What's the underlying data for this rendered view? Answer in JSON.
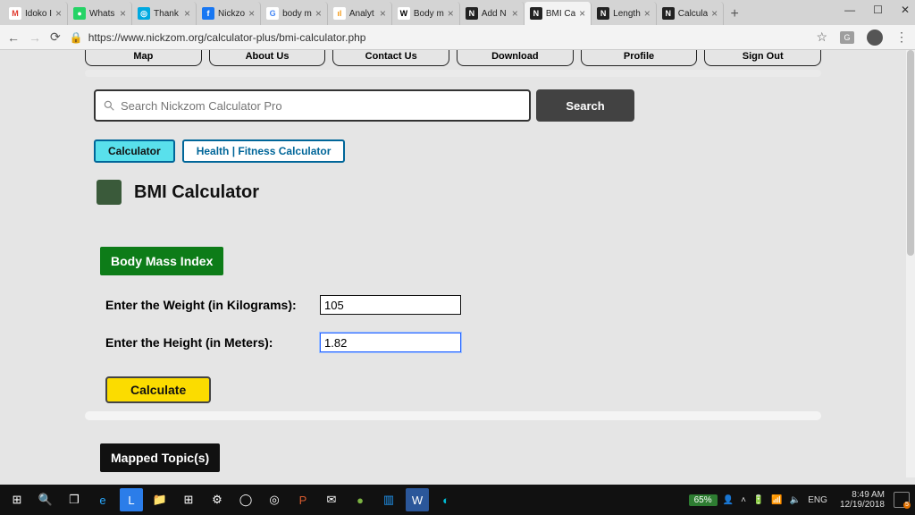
{
  "window_controls": {
    "min": "—",
    "max": "☐",
    "close": "✕"
  },
  "tabs": [
    {
      "title": "Idoko I",
      "color": "#e03a2e",
      "glyph": "M"
    },
    {
      "title": "Whats",
      "color": "#25d366",
      "glyph": "●"
    },
    {
      "title": "Thank",
      "color": "#00a9e0",
      "glyph": "◎"
    },
    {
      "title": "Nickzo",
      "color": "#1877f2",
      "glyph": "f"
    },
    {
      "title": "body m",
      "color": "#ffffff",
      "glyph": "G"
    },
    {
      "title": "Analyt",
      "color": "#f59c1a",
      "glyph": "ıl"
    },
    {
      "title": "Body m",
      "color": "#ffffff",
      "glyph": "W"
    },
    {
      "title": "Add N",
      "color": "#222222",
      "glyph": "N"
    },
    {
      "title": "BMI Ca",
      "color": "#222222",
      "glyph": "N",
      "active": true
    },
    {
      "title": "Length",
      "color": "#222222",
      "glyph": "N"
    },
    {
      "title": "Calcula",
      "color": "#222222",
      "glyph": "N"
    }
  ],
  "newtab": "+",
  "address": {
    "lock": "🔒",
    "url": "https://www.nickzom.org/calculator-plus/bmi-calculator.php",
    "star": "☆",
    "ext": "⋯",
    "menu": "⋮"
  },
  "topnav": [
    "Map",
    "About Us",
    "Contact Us",
    "Download",
    "Profile",
    "Sign Out"
  ],
  "search": {
    "placeholder": "Search Nickzom Calculator Pro",
    "button": "Search"
  },
  "chips": {
    "calc": "Calculator",
    "health": "Health | Fitness Calculator"
  },
  "page_title": "BMI Calculator",
  "bmi_badge": "Body Mass Index",
  "form": {
    "weight_label": "Enter the Weight (in Kilograms):",
    "weight_value": "105",
    "height_label": "Enter the Height (in Meters):",
    "height_value": "1.82",
    "calculate": "Calculate"
  },
  "mapped_badge": "Mapped Topic(s)",
  "tray": {
    "battery": "65%",
    "lang": "ENG",
    "time": "8:49 AM",
    "date": "12/19/2018",
    "notif_count": "5"
  }
}
